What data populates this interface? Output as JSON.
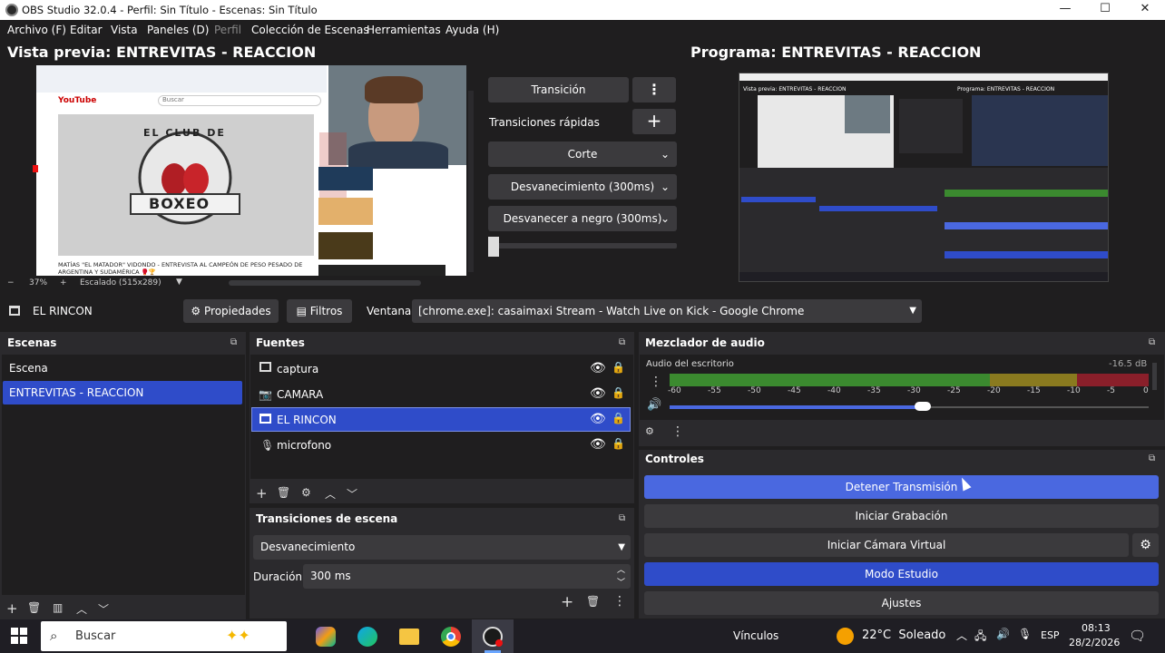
{
  "window": {
    "title": "OBS Studio 32.0.4 - Perfil: Sin Título - Escenas: Sin Título"
  },
  "menu": [
    "Archivo (F)",
    "Editar",
    "Vista",
    "Paneles (D)",
    "Perfil",
    "Colección de Escenas",
    "Herramientas",
    "Ayuda (H)"
  ],
  "preview": {
    "title": "Vista previa: ENTREVITAS  - REACCION",
    "zoom": "37%",
    "scale_label": "Escalado (515x289)",
    "embedded": {
      "youtube": "YouTube",
      "search_placeholder": "Buscar",
      "club_top": "EL CLUB DE",
      "club_main": "BOXEO",
      "video_caption": "MATÍAS \"EL MATADOR\" VIDONDO - ENTREVISTA AL CAMPEÓN DE PESO PESADO DE ARGENTINA Y SUDAMÉRICA 🥊🏆"
    }
  },
  "program": {
    "title": "Programa: ENTREVITAS  - REACCION",
    "mini_preview": "Vista previa: ENTREVITAS - REACCION",
    "mini_program": "Programa: ENTREVITAS - REACCION"
  },
  "transitions_dock": {
    "transition_btn": "Transición",
    "quick_label": "Transiciones rápidas",
    "items": [
      "Corte",
      "Desvanecimiento (300ms)",
      "Desvanecer a negro (300ms)"
    ]
  },
  "source_toolbar": {
    "source_name": "EL RINCON",
    "props_btn": "Propiedades",
    "filters_btn": "Filtros",
    "window_label": "Ventana",
    "window_value": "[chrome.exe]: casaimaxi Stream - Watch Live on Kick - Google Chrome"
  },
  "scenes": {
    "title": "Escenas",
    "items": [
      "Escena",
      "ENTREVITAS  - REACCION"
    ]
  },
  "sources": {
    "title": "Fuentes",
    "items": [
      "captura",
      "CAMARA",
      "EL RINCON",
      "microfono"
    ]
  },
  "scene_transitions": {
    "title": "Transiciones de escena",
    "selected": "Desvanecimiento",
    "duration_label": "Duración",
    "duration_value": "300 ms"
  },
  "audio": {
    "title": "Mezclador de audio",
    "channel": "Audio del escritorio",
    "db": "-16.5 dB",
    "ticks": [
      "-60",
      "-55",
      "-50",
      "-45",
      "-40",
      "-35",
      "-30",
      "-25",
      "-20",
      "-15",
      "-10",
      "-5",
      "0"
    ]
  },
  "controls": {
    "title": "Controles",
    "stop_stream": "Detener Transmisión",
    "start_record": "Iniciar Grabación",
    "virtual_cam": "Iniciar Cámara Virtual",
    "studio_mode": "Modo Estudio",
    "settings": "Ajustes"
  },
  "taskbar": {
    "search": "Buscar",
    "links": "Vínculos",
    "weather": "22°C  Soleado",
    "lang": "ESP",
    "time": "08:13",
    "date": "28/2/2026"
  },
  "colors": {
    "accent": "#2f4cc9",
    "stop_button": "#4a68e0",
    "meter_green": "#3b8a2f",
    "meter_yellow": "#8a7a1f",
    "meter_red": "#8a1f2a"
  }
}
